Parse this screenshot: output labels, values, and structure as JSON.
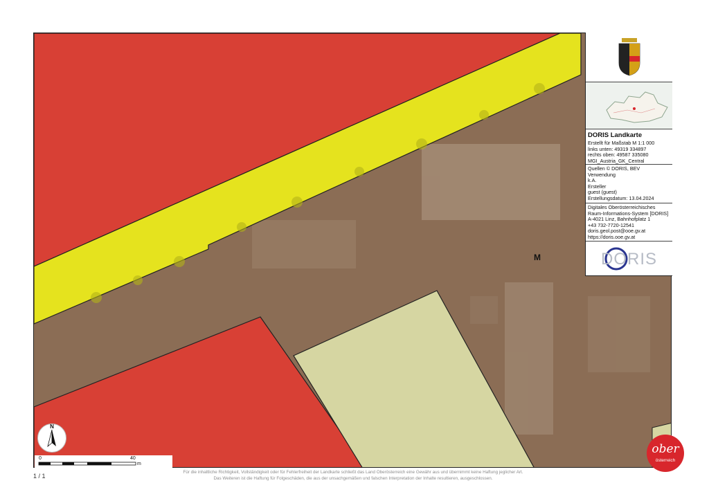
{
  "colors": {
    "zone_red": "#d84035",
    "zone_yellow": "#e5e31e",
    "zone_brown": "#8b6d55",
    "zone_green": "#d6d6a2",
    "outline": "#222222",
    "brand_red": "#d8262c",
    "doris_blue": "#2a3590"
  },
  "map": {
    "marker_letter": "M"
  },
  "info_panel": {
    "title": "DORIS Landkarte",
    "scale_lines": [
      "Erstellt für Maßstab M 1:1 000",
      "links unten: 49319 334897",
      "rechts oben: 49587 335080",
      "MGI_Austria_GK_Central"
    ],
    "meta_lines": [
      "Quellen © DORIS, BEV",
      "Verwendung",
      "k.A.",
      "Ersteller",
      "guest (guest)",
      "Erstellungsdatum: 13.04.2024"
    ],
    "contact_lines": [
      "Digitales Oberösterreichisches",
      "Raum-Informations-System [DORIS]",
      "A-4021 Linz, Bahnhofplatz 1",
      "+43 732-7720-12541",
      "doris.geol.post@ooe.gv.at",
      "https://doris.ooe.gv.at"
    ],
    "logo_text": "DORIS"
  },
  "north_arrow": {
    "label": "N"
  },
  "scalebar": {
    "start": "0",
    "end": "40",
    "unit": "m"
  },
  "footer": {
    "page": "1 / 1",
    "disclaimer_1": "Für die inhaltliche Richtigkeit, Vollständigkeit oder für Fehlerfreiheit der Landkarte schließt das Land Oberösterreich eine Gewähr aus und übernimmt keine Haftung jeglicher Art.",
    "disclaimer_2": "Das Weiteren ist die Haftung für Folgeschäden, die aus der unsachgemäßen und falschen Interpretation der Inhalte resultieren, ausgeschlossen."
  },
  "brand": {
    "logo_main": "ober",
    "logo_sub": "österreich"
  }
}
